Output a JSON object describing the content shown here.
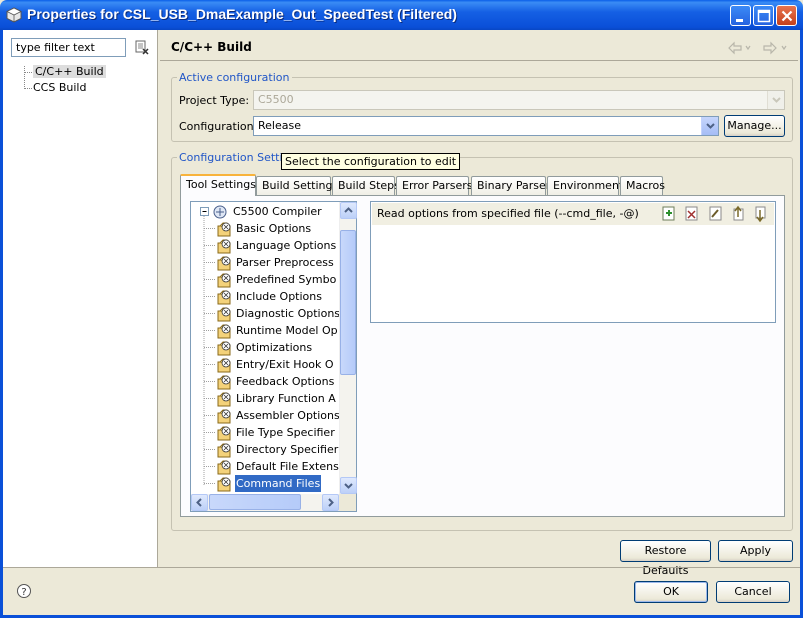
{
  "window": {
    "title": "Properties for CSL_USB_DmaExample_Out_SpeedTest (Filtered)",
    "title_bar_color": "#0a5fe8",
    "controls": [
      "minimize-icon",
      "maximize-icon",
      "close-icon"
    ]
  },
  "sidebar": {
    "filter_placeholder": "type filter text",
    "filter_value": "type filter text",
    "items": [
      {
        "label": "C/C++ Build",
        "selected": true
      },
      {
        "label": "CCS Build",
        "selected": false
      }
    ]
  },
  "page": {
    "title": "C/C++ Build",
    "nav": [
      "back-arrow-icon",
      "forward-arrow-icon"
    ]
  },
  "active_configuration": {
    "group_label": "Active configuration",
    "project_type_label": "Project Type:",
    "project_type_value": "C5500",
    "configuration_label": "Configuration:",
    "configuration_value": "Release",
    "manage_button": "Manage..."
  },
  "configuration_settings": {
    "group_label": "Configuration Settings",
    "tooltip": "Select the configuration to edit",
    "tabs": [
      {
        "label": "Tool Settings",
        "active": true
      },
      {
        "label": "Build Settings",
        "active": false
      },
      {
        "label": "Build Steps",
        "active": false
      },
      {
        "label": "Error Parsers",
        "active": false
      },
      {
        "label": "Binary Parser",
        "active": false
      },
      {
        "label": "Environment",
        "active": false
      },
      {
        "label": "Macros",
        "active": false
      }
    ],
    "tool_tree": {
      "root": "C5500 Compiler",
      "children": [
        "Basic Options",
        "Language Options",
        "Parser Preprocess",
        "Predefined Symbo",
        "Include Options",
        "Diagnostic Options",
        "Runtime Model Op",
        "Optimizations",
        "Entry/Exit Hook O",
        "Feedback Options",
        "Library Function A",
        "Assembler Options",
        "File Type Specifier",
        "Directory Specifier",
        "Default File Extens",
        "Command Files"
      ],
      "selected": "Command Files"
    },
    "options_panel": {
      "title": "Read options from specified file (--cmd_file, -@)",
      "toolbar": [
        "add-icon",
        "delete-icon",
        "edit-icon",
        "move-up-icon",
        "move-down-icon"
      ]
    }
  },
  "footer": {
    "restore_defaults": "Restore Defaults",
    "apply": "Apply",
    "ok": "OK",
    "cancel": "Cancel",
    "help_icon": "help-icon"
  },
  "colors": {
    "dialog_bg": "#ece9d8",
    "group_label": "#2156c7",
    "selection": "#316ac5",
    "tooltip_bg": "#ffffe1"
  }
}
